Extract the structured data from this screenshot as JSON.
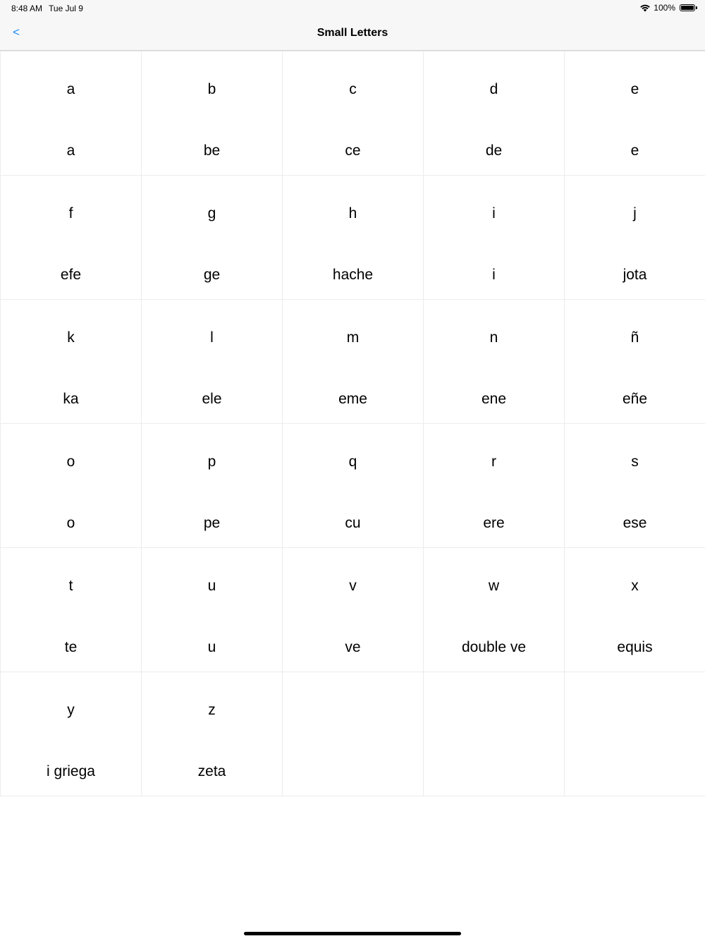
{
  "status_bar": {
    "time": "8:48 AM",
    "date": "Tue Jul 9",
    "battery": "100%",
    "icons": [
      "wifi-icon",
      "battery-icon"
    ]
  },
  "nav_bar": {
    "back_label": "<",
    "back_color": "#1a8cff",
    "title": "Small Letters"
  },
  "letters": [
    {
      "letter": "a",
      "name": "a"
    },
    {
      "letter": "b",
      "name": "be"
    },
    {
      "letter": "c",
      "name": "ce"
    },
    {
      "letter": "d",
      "name": "de"
    },
    {
      "letter": "e",
      "name": "e"
    },
    {
      "letter": "f",
      "name": "efe"
    },
    {
      "letter": "g",
      "name": "ge"
    },
    {
      "letter": "h",
      "name": "hache"
    },
    {
      "letter": "i",
      "name": "i"
    },
    {
      "letter": "j",
      "name": "jota"
    },
    {
      "letter": "k",
      "name": "ka"
    },
    {
      "letter": "l",
      "name": "ele"
    },
    {
      "letter": "m",
      "name": "eme"
    },
    {
      "letter": "n",
      "name": "ene"
    },
    {
      "letter": "ñ",
      "name": "eñe"
    },
    {
      "letter": "o",
      "name": "o"
    },
    {
      "letter": "p",
      "name": "pe"
    },
    {
      "letter": "q",
      "name": "cu"
    },
    {
      "letter": "r",
      "name": "ere"
    },
    {
      "letter": "s",
      "name": "ese"
    },
    {
      "letter": "t",
      "name": "te"
    },
    {
      "letter": "u",
      "name": "u"
    },
    {
      "letter": "v",
      "name": "ve"
    },
    {
      "letter": "w",
      "name": "double ve"
    },
    {
      "letter": "x",
      "name": "equis"
    },
    {
      "letter": "y",
      "name": "i griega"
    },
    {
      "letter": "z",
      "name": "zeta"
    }
  ]
}
